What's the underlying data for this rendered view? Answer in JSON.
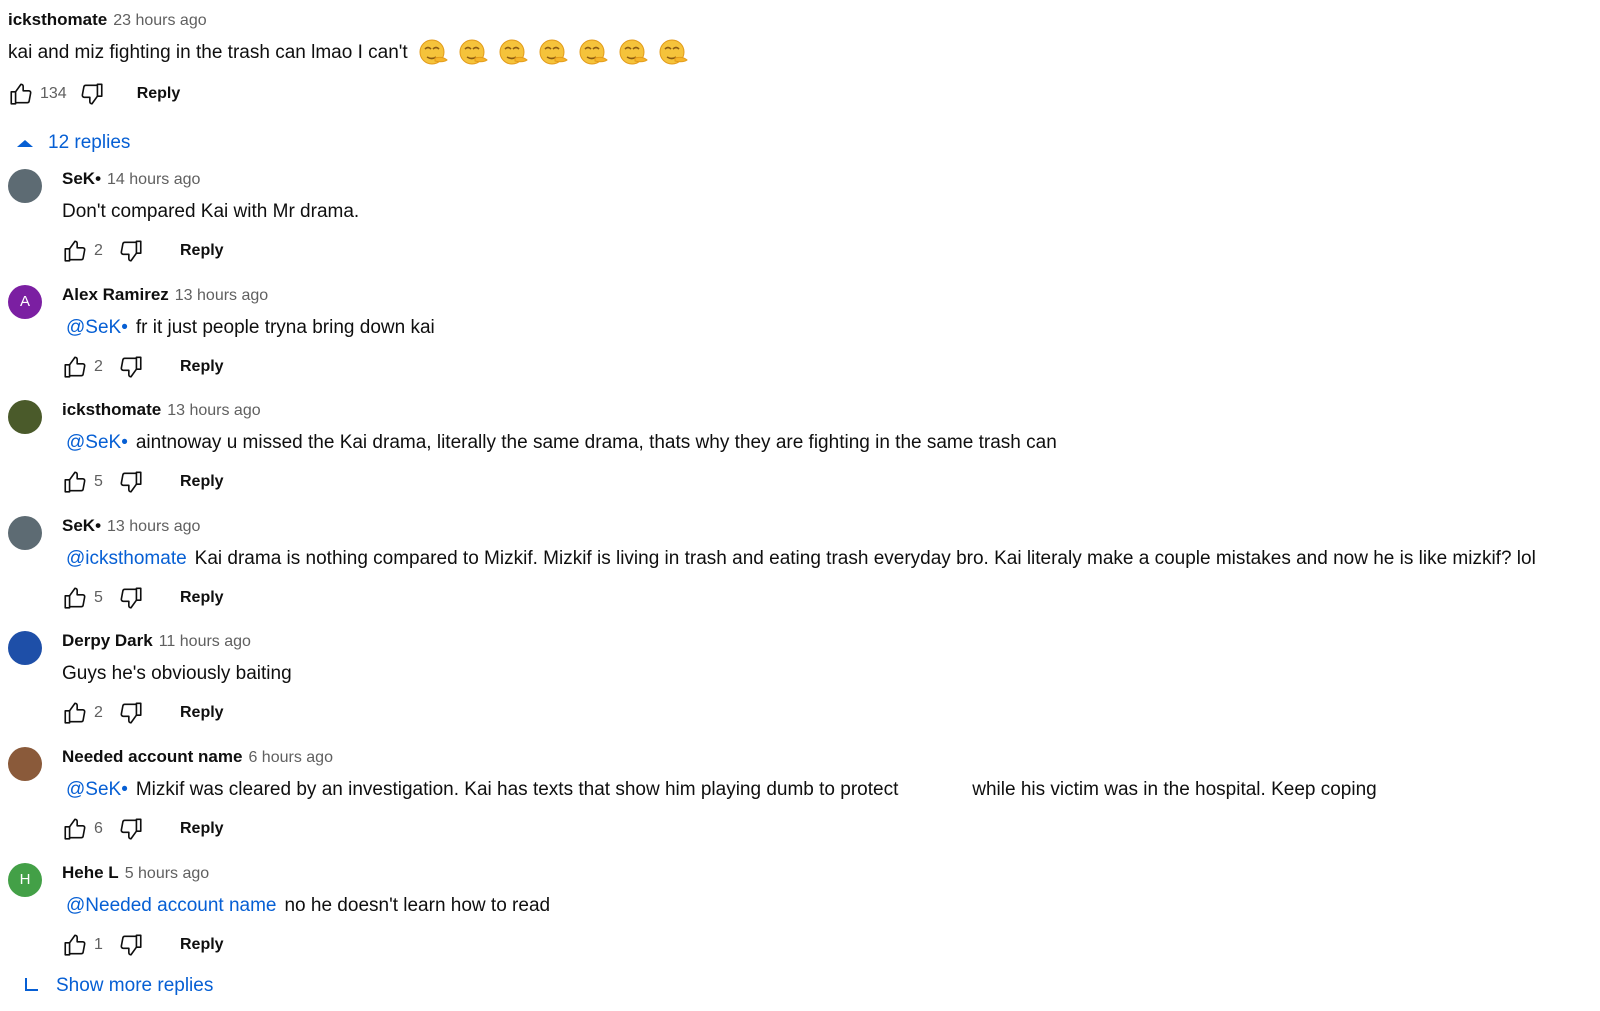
{
  "top_comment": {
    "author": "icksthomate",
    "time": "23 hours ago",
    "text": "kai and miz fighting in the trash can lmao I can't",
    "emoji_icons": [
      "shushing-face-icon",
      "shushing-face-icon",
      "shushing-face-icon",
      "shushing-face-icon",
      "shushing-face-icon",
      "shushing-face-icon",
      "shushing-face-icon"
    ],
    "likes": "134",
    "reply_label": "Reply"
  },
  "replies_toggle": {
    "label": "12 replies",
    "icon": "chevron-up-icon"
  },
  "replies": [
    {
      "author": "SeK•",
      "time": "14 hours ago",
      "mention": "",
      "text": "Don't compared Kai with Mr drama.",
      "likes": "2",
      "reply_label": "Reply",
      "avatar_color": "#5d6b73",
      "avatar_letter": ""
    },
    {
      "author": "Alex Ramirez",
      "time": "13 hours ago",
      "mention": "@SeK•",
      "text": "fr it just people tryna bring down kai",
      "likes": "2",
      "reply_label": "Reply",
      "avatar_color": "#7b1fa2",
      "avatar_letter": "A"
    },
    {
      "author": "icksthomate",
      "time": "13 hours ago",
      "mention": "@SeK•",
      "text": "aintnoway u missed the Kai drama, literally the same drama, thats why they are fighting in the same trash can",
      "likes": "5",
      "reply_label": "Reply",
      "avatar_color": "#4a5a2a",
      "avatar_letter": ""
    },
    {
      "author": "SeK•",
      "time": "13 hours ago",
      "mention": "@icksthomate",
      "text": "Kai drama is nothing compared to Mizkif. Mizkif is living in trash and eating trash everyday bro. Kai literaly make a couple mistakes and now he is like mizkif? lol",
      "likes": "5",
      "reply_label": "Reply",
      "avatar_color": "#5d6b73",
      "avatar_letter": ""
    },
    {
      "author": "Derpy Dark",
      "time": "11 hours ago",
      "mention": "",
      "text": "Guys he's obviously baiting",
      "likes": "2",
      "reply_label": "Reply",
      "avatar_color": "#1e4fa8",
      "avatar_letter": ""
    },
    {
      "author": "Needed account name",
      "time": "6 hours ago",
      "mention": "@SeK•",
      "text": "Mizkif was cleared by an investigation. Kai has texts that show him playing dumb to protect              while his victim was in the hospital. Keep coping",
      "likes": "6",
      "reply_label": "Reply",
      "avatar_color": "#8a5a3a",
      "avatar_letter": ""
    },
    {
      "author": "Hehe L",
      "time": "5 hours ago",
      "mention": "@Needed account name",
      "text": "no he doesn't learn how to read",
      "likes": "1",
      "reply_label": "Reply",
      "avatar_color": "#43a047",
      "avatar_letter": "H"
    }
  ],
  "show_more": {
    "label": "Show more replies"
  },
  "colors": {
    "link": "#065fd4",
    "meta": "#606060",
    "text": "#0f0f0f"
  }
}
